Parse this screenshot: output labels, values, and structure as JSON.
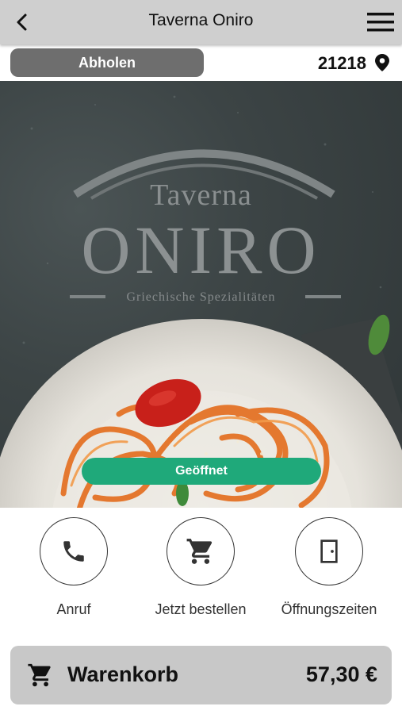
{
  "header": {
    "title": "Taverna Oniro",
    "back_icon": "chevron-left-icon",
    "menu_icon": "hamburger-menu-icon"
  },
  "subbar": {
    "pickup_label": "Abholen",
    "zip": "21218",
    "pin_icon": "location-pin-icon"
  },
  "hero": {
    "logo_line1": "Taverna",
    "logo_line2": "ONIRO",
    "logo_line3": "Griechische Spezialitäten",
    "status": "Geöffnet",
    "status_color": "#1fa97a"
  },
  "actions": [
    {
      "label": "Anruf",
      "icon": "phone-icon"
    },
    {
      "label": "Jetzt bestellen",
      "icon": "shopping-cart-icon"
    },
    {
      "label": "Öffnungszeiten",
      "icon": "door-icon"
    }
  ],
  "cart": {
    "label": "Warenkorb",
    "total": "57,30 €",
    "icon": "shopping-cart-icon"
  }
}
